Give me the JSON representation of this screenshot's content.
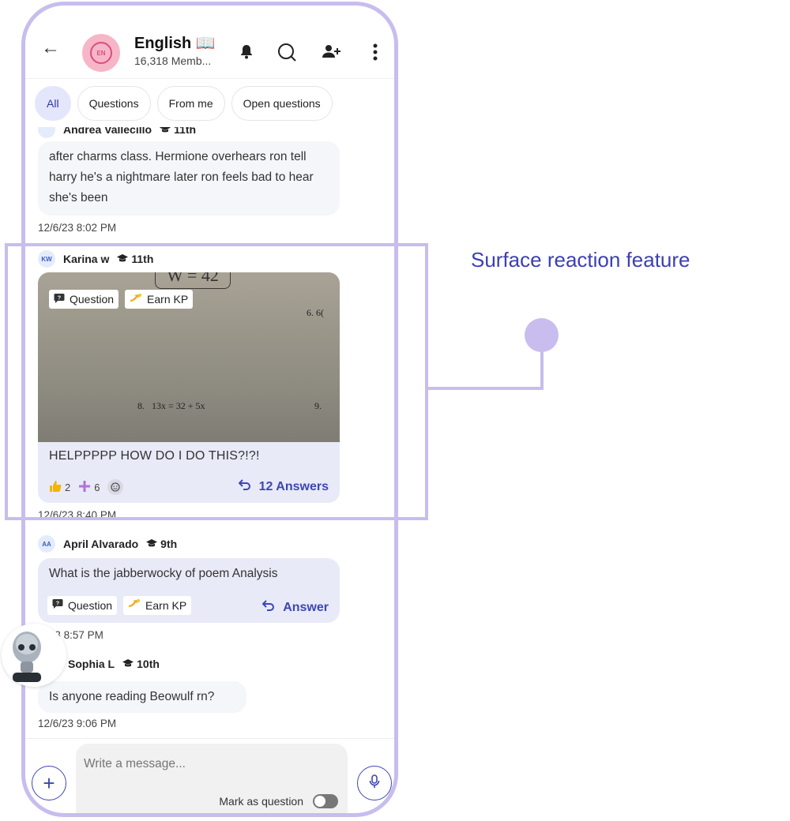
{
  "header": {
    "group_initials": "EN",
    "title": "English 📖",
    "subtitle": "16,318 Memb..."
  },
  "tabs": [
    {
      "label": "All",
      "active": true
    },
    {
      "label": "Questions",
      "active": false
    },
    {
      "label": "From me",
      "active": false
    },
    {
      "label": "Open questions",
      "active": false
    }
  ],
  "messages": [
    {
      "author": "Andrea Vallecillo",
      "grade": "11th",
      "text": "after charms class. Hermione overhears ron tell harry he's a nightmare later ron feels bad to hear she's been",
      "time": "12/6/23 8:02 PM"
    },
    {
      "initials": "KW",
      "author": "Karina w",
      "grade": "11th",
      "tags": [
        "Question",
        "Earn KP"
      ],
      "image_text": [
        "W = 42",
        "6.  6(",
        "8.   13x = 32 + 5x",
        "9."
      ],
      "text": "HELPPPPP HOW DO I DO THIS?!?!",
      "reactions": [
        {
          "icon": "thumbs-up",
          "count": "2"
        },
        {
          "icon": "plus-one",
          "count": "6"
        }
      ],
      "answers_label": "12 Answers",
      "time": "12/6/23 8:40 PM"
    },
    {
      "initials": "AA",
      "author": "April Alvarado",
      "grade": "9th",
      "text": "What is the jabberwocky of poem Analysis",
      "tags": [
        "Question",
        "Earn KP"
      ],
      "answer_label": "Answer",
      "time": "'3/23 8:57 PM"
    },
    {
      "author": "Sophia L",
      "grade": "10th",
      "text": "Is anyone reading Beowulf rn?",
      "time": "12/6/23 9:06 PM"
    }
  ],
  "composer": {
    "placeholder": "Write a message...",
    "mark_label": "Mark as question"
  },
  "annotation": "Surface reaction feature",
  "colors": {
    "accent": "#3c47b3",
    "outline": "#c8bdee",
    "pink": "#f7b6c8"
  }
}
